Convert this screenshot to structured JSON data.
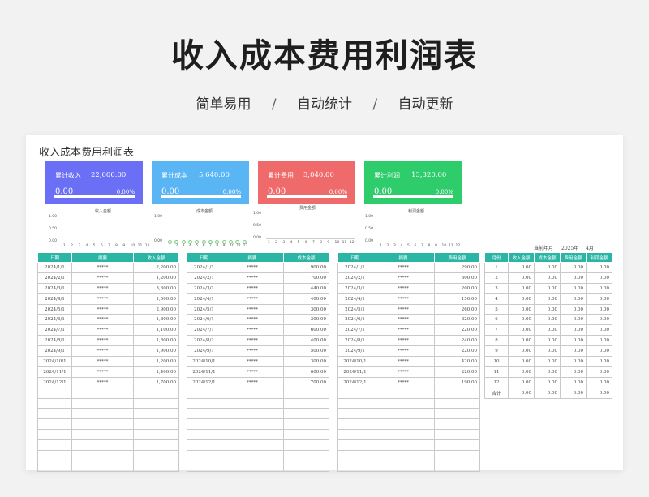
{
  "hero": {
    "title": "收入成本费用利润表",
    "subtitle": [
      "简单易用",
      "/",
      "自动统计",
      "/",
      "自动更新"
    ]
  },
  "sheet": {
    "title": "收入成本费用利润表",
    "cards": [
      {
        "label": "累计收入",
        "value": "22,000.00",
        "amount": "0.00",
        "pct": "0.00%",
        "color": "#6a6ff5"
      },
      {
        "label": "累计成本",
        "value": "5,640.00",
        "amount": "0.00",
        "pct": "0.00%",
        "color": "#5ab5f5"
      },
      {
        "label": "累计费用",
        "value": "3,040.00",
        "amount": "0.00",
        "pct": "0.00%",
        "color": "#ef6b6b"
      },
      {
        "label": "累计利润",
        "value": "13,320.00",
        "amount": "0.00",
        "pct": "0.00%",
        "color": "#2fcc6c"
      }
    ],
    "period": {
      "label": "当前年月",
      "year": "2025年",
      "month": "4月"
    },
    "revenue_table": {
      "headers": [
        "日期",
        "摘要",
        "收入金额"
      ],
      "rows": [
        [
          "2024/1/1",
          "*****",
          "2,200.00"
        ],
        [
          "2024/2/1",
          "*****",
          "1,200.00"
        ],
        [
          "2024/3/1",
          "*****",
          "3,300.00"
        ],
        [
          "2024/4/1",
          "*****",
          "1,500.00"
        ],
        [
          "2024/5/1",
          "*****",
          "2,900.00"
        ],
        [
          "2024/6/1",
          "*****",
          "1,800.00"
        ],
        [
          "2024/7/1",
          "*****",
          "1,100.00"
        ],
        [
          "2024/8/1",
          "*****",
          "1,800.00"
        ],
        [
          "2024/9/1",
          "*****",
          "1,900.00"
        ],
        [
          "2024/10/1",
          "*****",
          "1,200.00"
        ],
        [
          "2024/11/1",
          "*****",
          "1,400.00"
        ],
        [
          "2024/12/1",
          "*****",
          "1,700.00"
        ]
      ]
    },
    "cost_table": {
      "headers": [
        "日期",
        "摘要",
        "成本金额"
      ],
      "rows": [
        [
          "2024/1/1",
          "*****",
          "900.00"
        ],
        [
          "2024/2/1",
          "*****",
          "700.00"
        ],
        [
          "2024/3/1",
          "*****",
          "440.00"
        ],
        [
          "2024/4/1",
          "*****",
          "400.00"
        ],
        [
          "2024/5/1",
          "*****",
          "300.00"
        ],
        [
          "2024/6/1",
          "*****",
          "300.00"
        ],
        [
          "2024/7/1",
          "*****",
          "600.00"
        ],
        [
          "2024/8/1",
          "*****",
          "400.00"
        ],
        [
          "2024/9/1",
          "*****",
          "500.00"
        ],
        [
          "2024/10/1",
          "*****",
          "300.00"
        ],
        [
          "2024/11/1",
          "*****",
          "600.00"
        ],
        [
          "2024/12/1",
          "*****",
          "700.00"
        ]
      ]
    },
    "expense_table": {
      "headers": [
        "日期",
        "摘要",
        "费用金额"
      ],
      "rows": [
        [
          "2024/1/1",
          "*****",
          "290.00"
        ],
        [
          "2024/2/1",
          "*****",
          "300.00"
        ],
        [
          "2024/3/1",
          "*****",
          "200.00"
        ],
        [
          "2024/4/1",
          "*****",
          "150.00"
        ],
        [
          "2024/5/1",
          "*****",
          "260.00"
        ],
        [
          "2024/6/1",
          "*****",
          "320.00"
        ],
        [
          "2024/7/1",
          "*****",
          "220.00"
        ],
        [
          "2024/8/1",
          "*****",
          "240.00"
        ],
        [
          "2024/9/1",
          "*****",
          "220.00"
        ],
        [
          "2024/10/1",
          "*****",
          "420.00"
        ],
        [
          "2024/11/1",
          "*****",
          "220.00"
        ],
        [
          "2024/12/1",
          "*****",
          "190.00"
        ]
      ]
    },
    "summary_table": {
      "headers": [
        "月份",
        "收入金额",
        "成本金额",
        "费用金额",
        "利润金额"
      ],
      "rows": [
        [
          "1",
          "0.00",
          "0.00",
          "0.00",
          "0.00"
        ],
        [
          "2",
          "0.00",
          "0.00",
          "0.00",
          "0.00"
        ],
        [
          "3",
          "0.00",
          "0.00",
          "0.00",
          "0.00"
        ],
        [
          "4",
          "0.00",
          "0.00",
          "0.00",
          "0.00"
        ],
        [
          "5",
          "0.00",
          "0.00",
          "0.00",
          "0.00"
        ],
        [
          "6",
          "0.00",
          "0.00",
          "0.00",
          "0.00"
        ],
        [
          "7",
          "0.00",
          "0.00",
          "0.00",
          "0.00"
        ],
        [
          "8",
          "0.00",
          "0.00",
          "0.00",
          "0.00"
        ],
        [
          "9",
          "0.00",
          "0.00",
          "0.00",
          "0.00"
        ],
        [
          "10",
          "0.00",
          "0.00",
          "0.00",
          "0.00"
        ],
        [
          "11",
          "0.00",
          "0.00",
          "0.00",
          "0.00"
        ],
        [
          "12",
          "0.00",
          "0.00",
          "0.00",
          "0.00"
        ],
        [
          "合计",
          "0.00",
          "0.00",
          "0.00",
          "0.00"
        ]
      ]
    }
  },
  "chart_data": [
    {
      "type": "line",
      "title": "收入金额",
      "categories": [
        "1",
        "2",
        "3",
        "4",
        "5",
        "6",
        "7",
        "8",
        "9",
        "10",
        "11",
        "12"
      ],
      "yticks": [
        "1.00",
        "0.50",
        "0.00"
      ],
      "values": [
        0,
        0,
        0,
        0,
        0,
        0,
        0,
        0,
        0,
        0,
        0,
        0
      ],
      "ylim": [
        0,
        1
      ]
    },
    {
      "type": "line",
      "title": "成本金额",
      "categories": [
        "1",
        "2",
        "3",
        "4",
        "5",
        "6",
        "7",
        "8",
        "9",
        "10",
        "11",
        "12"
      ],
      "yticks": [
        "1.00",
        "0.00"
      ],
      "values": [
        0,
        0,
        0,
        0,
        0,
        0,
        0,
        0,
        0,
        0,
        0,
        0
      ],
      "ylim": [
        0,
        1
      ],
      "markers": true
    },
    {
      "type": "line",
      "title": "费用金额",
      "categories": [
        "1",
        "2",
        "3",
        "4",
        "5",
        "6",
        "7",
        "8",
        "9",
        "10",
        "11",
        "12"
      ],
      "yticks": [
        "1.00",
        "0.50",
        "0.00"
      ],
      "values": [
        0,
        0,
        0,
        0,
        0,
        0,
        0,
        0,
        0,
        0,
        0,
        0
      ],
      "ylim": [
        0,
        1
      ]
    },
    {
      "type": "line",
      "title": "利润金额",
      "categories": [
        "1",
        "2",
        "3",
        "4",
        "5",
        "6",
        "7",
        "8",
        "9",
        "10",
        "11",
        "12"
      ],
      "yticks": [
        "1.00",
        "0.50",
        "0.00"
      ],
      "values": [
        0,
        0,
        0,
        0,
        0,
        0,
        0,
        0,
        0,
        0,
        0,
        0
      ],
      "ylim": [
        0,
        1
      ]
    }
  ]
}
